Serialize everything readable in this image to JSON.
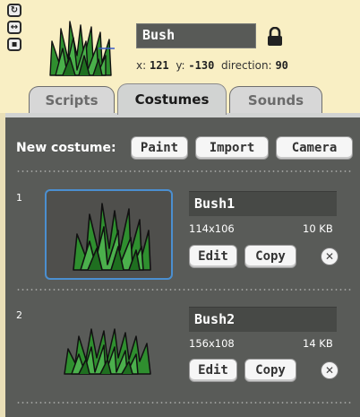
{
  "sprite": {
    "name": "Bush",
    "x_label": "x:",
    "x_value": "121",
    "y_label": "y:",
    "y_value": "-130",
    "direction_label": "direction:",
    "direction_value": "90"
  },
  "rotation_buttons": [
    "rotate-icon",
    "left-right-icon",
    "no-rotate-icon"
  ],
  "tabs": [
    {
      "label": "Scripts",
      "active": false
    },
    {
      "label": "Costumes",
      "active": true
    },
    {
      "label": "Sounds",
      "active": false
    }
  ],
  "new_costume": {
    "label": "New costume:",
    "paint": "Paint",
    "import": "Import",
    "camera": "Camera"
  },
  "costumes": [
    {
      "index": "1",
      "name": "Bush1",
      "size": "114x106",
      "filesize": "10 KB",
      "edit": "Edit",
      "copy": "Copy",
      "selected": true
    },
    {
      "index": "2",
      "name": "Bush2",
      "size": "156x108",
      "filesize": "14 KB",
      "edit": "Edit",
      "copy": "Copy",
      "selected": false
    }
  ],
  "colors": {
    "selection_border": "#4b8fd0",
    "panel": "#595b58",
    "header_bg": "#f9efc4"
  }
}
